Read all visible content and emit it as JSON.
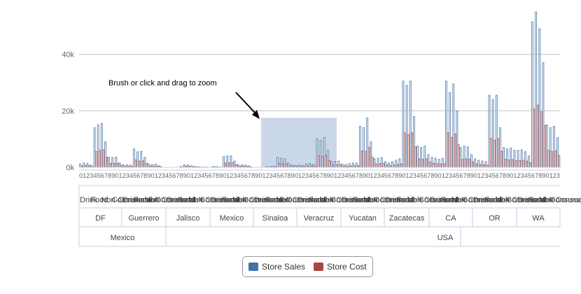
{
  "hint": "Brush or click and drag to zoom",
  "legend": {
    "items": [
      {
        "label": "Store Sales",
        "color": "#4572A7"
      },
      {
        "label": "Store Cost",
        "color": "#AA4643"
      }
    ]
  },
  "chart_data": {
    "type": "bar",
    "ylim": [
      0,
      56000
    ],
    "y_ticks": [
      "0k",
      "20k",
      "40k"
    ],
    "tick_values": [
      0,
      20000,
      40000
    ],
    "grid": true,
    "brush_range": [
      0,
      17500
    ],
    "hierarchy": {
      "countries": [
        {
          "name": "Mexico",
          "states": [
            "DF",
            "Guerrero"
          ]
        },
        {
          "name": "USA",
          "states": [
            "Jalisco",
            "Mexico",
            "Sinaloa",
            "Veracruz",
            "Yucatan",
            "Zacatecas",
            "CA",
            "OR",
            "WA"
          ]
        }
      ],
      "department_labels": [
        "Drink",
        "Food",
        "Non-Consumable",
        "Consumable"
      ]
    },
    "series": [
      {
        "name": "Store Sales",
        "color": "#4572A7",
        "values": [
          1200,
          1500,
          1400,
          800,
          14000,
          15000,
          15500,
          9000,
          3500,
          3500,
          3600,
          1500,
          900,
          900,
          800,
          6500,
          5500,
          5600,
          3500,
          1200,
          1000,
          1100,
          500,
          0,
          0,
          0,
          0,
          0,
          300,
          900,
          800,
          500,
          300,
          200,
          100,
          100,
          0,
          300,
          200,
          100,
          3800,
          4000,
          4000,
          2200,
          1000,
          900,
          800,
          500,
          0,
          0,
          0,
          0,
          200,
          300,
          400,
          3500,
          3200,
          3000,
          1500,
          800,
          700,
          800,
          600,
          1200,
          1300,
          1000,
          10000,
          9500,
          10500,
          6000,
          2000,
          2100,
          2200,
          1200,
          1000,
          1300,
          1500,
          1500,
          14500,
          14000,
          17500,
          9000,
          3000,
          3200,
          3500,
          2000,
          1500,
          2000,
          2500,
          3000,
          30500,
          29000,
          30500,
          18000,
          7500,
          7000,
          7500,
          4500,
          3500,
          3200,
          2800,
          3200,
          30500,
          26500,
          29500,
          20000,
          7000,
          7500,
          7200,
          4500,
          3000,
          2500,
          2200,
          2000,
          25500,
          24000,
          25500,
          14000,
          7000,
          6500,
          6800,
          6000,
          6000,
          6200,
          5500,
          4000,
          51500,
          55000,
          49000,
          37000,
          15000,
          14000,
          14500,
          10500
        ]
      },
      {
        "name": "Store Cost",
        "color": "#AA4643",
        "values": [
          480,
          600,
          560,
          320,
          5600,
          6000,
          6200,
          3600,
          1400,
          1400,
          1440,
          600,
          360,
          360,
          320,
          2600,
          2200,
          2240,
          1400,
          480,
          400,
          440,
          200,
          0,
          0,
          0,
          0,
          0,
          120,
          360,
          320,
          200,
          120,
          80,
          40,
          40,
          0,
          120,
          80,
          40,
          1520,
          1600,
          1600,
          880,
          400,
          360,
          320,
          200,
          0,
          0,
          0,
          0,
          80,
          120,
          160,
          1400,
          1280,
          1200,
          600,
          320,
          280,
          320,
          240,
          480,
          520,
          400,
          4000,
          3800,
          4200,
          2400,
          800,
          840,
          880,
          480,
          400,
          520,
          600,
          600,
          5800,
          5600,
          7000,
          3600,
          1200,
          1280,
          1400,
          800,
          600,
          800,
          1000,
          1200,
          12200,
          11600,
          12200,
          7200,
          3000,
          2800,
          3000,
          1800,
          1400,
          1280,
          1120,
          1280,
          12200,
          10600,
          11800,
          8000,
          2800,
          3000,
          2880,
          1800,
          1200,
          1000,
          880,
          800,
          10200,
          9600,
          10200,
          5600,
          2800,
          2600,
          2720,
          2400,
          2400,
          2480,
          2200,
          1600,
          20600,
          22000,
          19600,
          14800,
          6000,
          5600,
          5800,
          4200
        ]
      }
    ]
  }
}
